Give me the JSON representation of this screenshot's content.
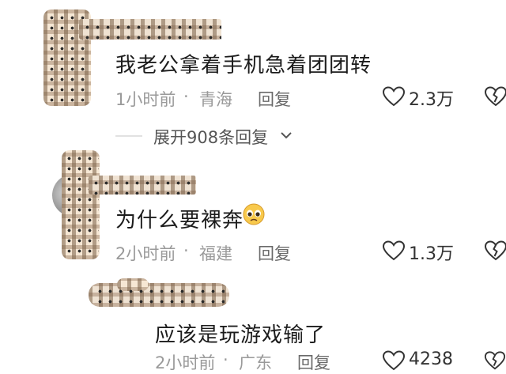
{
  "comments": [
    {
      "text": "我老公拿着手机急着团团转",
      "time": "1小时前",
      "separator": "·",
      "location": "青海",
      "reply_label": "回复",
      "likes": "2.3万",
      "expand": {
        "label": "展开908条回复",
        "icon": "chevron-down-icon"
      }
    },
    {
      "text": "为什么要裸奔",
      "emoji": "pleading-face-emoji",
      "time": "2小时前",
      "separator": "·",
      "location": "福建",
      "reply_label": "回复",
      "likes": "1.3万"
    },
    {
      "text": "应该是玩游戏输了",
      "time": "2小时前",
      "separator": "·",
      "location": "广东",
      "reply_label": "回复",
      "likes": "4238"
    }
  ],
  "icons": {
    "like": "heart-icon",
    "dislike": "broken-heart-icon"
  },
  "colors": {
    "text": "#1c1c1c",
    "meta": "#9a9a9a",
    "icon": "#333333",
    "mosaic": "#f6e7d4"
  }
}
